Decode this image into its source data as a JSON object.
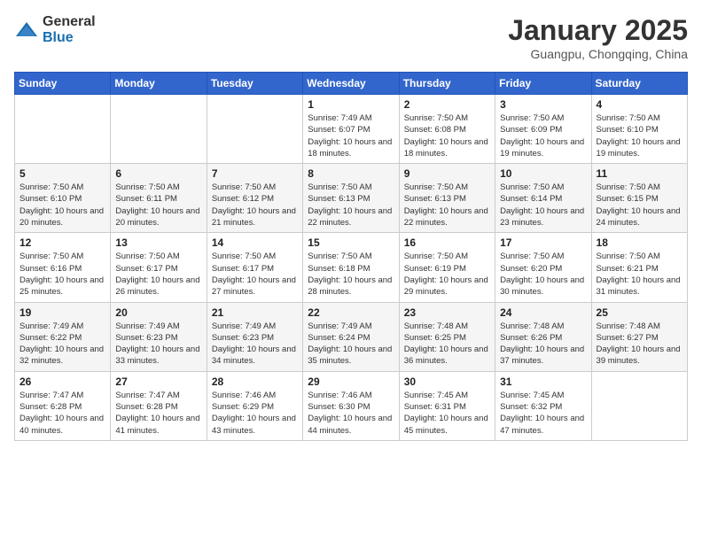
{
  "header": {
    "logo_general": "General",
    "logo_blue": "Blue",
    "title": "January 2025",
    "subtitle": "Guangpu, Chongqing, China"
  },
  "weekdays": [
    "Sunday",
    "Monday",
    "Tuesday",
    "Wednesday",
    "Thursday",
    "Friday",
    "Saturday"
  ],
  "weeks": [
    [
      {
        "day": "",
        "info": ""
      },
      {
        "day": "",
        "info": ""
      },
      {
        "day": "",
        "info": ""
      },
      {
        "day": "1",
        "info": "Sunrise: 7:49 AM\nSunset: 6:07 PM\nDaylight: 10 hours and 18 minutes."
      },
      {
        "day": "2",
        "info": "Sunrise: 7:50 AM\nSunset: 6:08 PM\nDaylight: 10 hours and 18 minutes."
      },
      {
        "day": "3",
        "info": "Sunrise: 7:50 AM\nSunset: 6:09 PM\nDaylight: 10 hours and 19 minutes."
      },
      {
        "day": "4",
        "info": "Sunrise: 7:50 AM\nSunset: 6:10 PM\nDaylight: 10 hours and 19 minutes."
      }
    ],
    [
      {
        "day": "5",
        "info": "Sunrise: 7:50 AM\nSunset: 6:10 PM\nDaylight: 10 hours and 20 minutes."
      },
      {
        "day": "6",
        "info": "Sunrise: 7:50 AM\nSunset: 6:11 PM\nDaylight: 10 hours and 20 minutes."
      },
      {
        "day": "7",
        "info": "Sunrise: 7:50 AM\nSunset: 6:12 PM\nDaylight: 10 hours and 21 minutes."
      },
      {
        "day": "8",
        "info": "Sunrise: 7:50 AM\nSunset: 6:13 PM\nDaylight: 10 hours and 22 minutes."
      },
      {
        "day": "9",
        "info": "Sunrise: 7:50 AM\nSunset: 6:13 PM\nDaylight: 10 hours and 22 minutes."
      },
      {
        "day": "10",
        "info": "Sunrise: 7:50 AM\nSunset: 6:14 PM\nDaylight: 10 hours and 23 minutes."
      },
      {
        "day": "11",
        "info": "Sunrise: 7:50 AM\nSunset: 6:15 PM\nDaylight: 10 hours and 24 minutes."
      }
    ],
    [
      {
        "day": "12",
        "info": "Sunrise: 7:50 AM\nSunset: 6:16 PM\nDaylight: 10 hours and 25 minutes."
      },
      {
        "day": "13",
        "info": "Sunrise: 7:50 AM\nSunset: 6:17 PM\nDaylight: 10 hours and 26 minutes."
      },
      {
        "day": "14",
        "info": "Sunrise: 7:50 AM\nSunset: 6:17 PM\nDaylight: 10 hours and 27 minutes."
      },
      {
        "day": "15",
        "info": "Sunrise: 7:50 AM\nSunset: 6:18 PM\nDaylight: 10 hours and 28 minutes."
      },
      {
        "day": "16",
        "info": "Sunrise: 7:50 AM\nSunset: 6:19 PM\nDaylight: 10 hours and 29 minutes."
      },
      {
        "day": "17",
        "info": "Sunrise: 7:50 AM\nSunset: 6:20 PM\nDaylight: 10 hours and 30 minutes."
      },
      {
        "day": "18",
        "info": "Sunrise: 7:50 AM\nSunset: 6:21 PM\nDaylight: 10 hours and 31 minutes."
      }
    ],
    [
      {
        "day": "19",
        "info": "Sunrise: 7:49 AM\nSunset: 6:22 PM\nDaylight: 10 hours and 32 minutes."
      },
      {
        "day": "20",
        "info": "Sunrise: 7:49 AM\nSunset: 6:23 PM\nDaylight: 10 hours and 33 minutes."
      },
      {
        "day": "21",
        "info": "Sunrise: 7:49 AM\nSunset: 6:23 PM\nDaylight: 10 hours and 34 minutes."
      },
      {
        "day": "22",
        "info": "Sunrise: 7:49 AM\nSunset: 6:24 PM\nDaylight: 10 hours and 35 minutes."
      },
      {
        "day": "23",
        "info": "Sunrise: 7:48 AM\nSunset: 6:25 PM\nDaylight: 10 hours and 36 minutes."
      },
      {
        "day": "24",
        "info": "Sunrise: 7:48 AM\nSunset: 6:26 PM\nDaylight: 10 hours and 37 minutes."
      },
      {
        "day": "25",
        "info": "Sunrise: 7:48 AM\nSunset: 6:27 PM\nDaylight: 10 hours and 39 minutes."
      }
    ],
    [
      {
        "day": "26",
        "info": "Sunrise: 7:47 AM\nSunset: 6:28 PM\nDaylight: 10 hours and 40 minutes."
      },
      {
        "day": "27",
        "info": "Sunrise: 7:47 AM\nSunset: 6:28 PM\nDaylight: 10 hours and 41 minutes."
      },
      {
        "day": "28",
        "info": "Sunrise: 7:46 AM\nSunset: 6:29 PM\nDaylight: 10 hours and 43 minutes."
      },
      {
        "day": "29",
        "info": "Sunrise: 7:46 AM\nSunset: 6:30 PM\nDaylight: 10 hours and 44 minutes."
      },
      {
        "day": "30",
        "info": "Sunrise: 7:45 AM\nSunset: 6:31 PM\nDaylight: 10 hours and 45 minutes."
      },
      {
        "day": "31",
        "info": "Sunrise: 7:45 AM\nSunset: 6:32 PM\nDaylight: 10 hours and 47 minutes."
      },
      {
        "day": "",
        "info": ""
      }
    ]
  ]
}
